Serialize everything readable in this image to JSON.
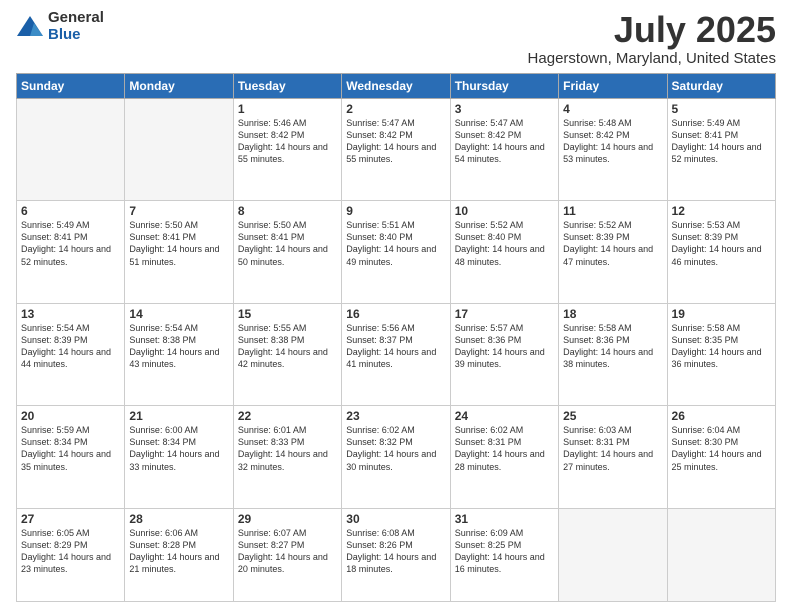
{
  "logo": {
    "general": "General",
    "blue": "Blue"
  },
  "title": "July 2025",
  "location": "Hagerstown, Maryland, United States",
  "days_of_week": [
    "Sunday",
    "Monday",
    "Tuesday",
    "Wednesday",
    "Thursday",
    "Friday",
    "Saturday"
  ],
  "weeks": [
    [
      {
        "day": "",
        "info": ""
      },
      {
        "day": "",
        "info": ""
      },
      {
        "day": "1",
        "info": "Sunrise: 5:46 AM\nSunset: 8:42 PM\nDaylight: 14 hours and 55 minutes."
      },
      {
        "day": "2",
        "info": "Sunrise: 5:47 AM\nSunset: 8:42 PM\nDaylight: 14 hours and 55 minutes."
      },
      {
        "day": "3",
        "info": "Sunrise: 5:47 AM\nSunset: 8:42 PM\nDaylight: 14 hours and 54 minutes."
      },
      {
        "day": "4",
        "info": "Sunrise: 5:48 AM\nSunset: 8:42 PM\nDaylight: 14 hours and 53 minutes."
      },
      {
        "day": "5",
        "info": "Sunrise: 5:49 AM\nSunset: 8:41 PM\nDaylight: 14 hours and 52 minutes."
      }
    ],
    [
      {
        "day": "6",
        "info": "Sunrise: 5:49 AM\nSunset: 8:41 PM\nDaylight: 14 hours and 52 minutes."
      },
      {
        "day": "7",
        "info": "Sunrise: 5:50 AM\nSunset: 8:41 PM\nDaylight: 14 hours and 51 minutes."
      },
      {
        "day": "8",
        "info": "Sunrise: 5:50 AM\nSunset: 8:41 PM\nDaylight: 14 hours and 50 minutes."
      },
      {
        "day": "9",
        "info": "Sunrise: 5:51 AM\nSunset: 8:40 PM\nDaylight: 14 hours and 49 minutes."
      },
      {
        "day": "10",
        "info": "Sunrise: 5:52 AM\nSunset: 8:40 PM\nDaylight: 14 hours and 48 minutes."
      },
      {
        "day": "11",
        "info": "Sunrise: 5:52 AM\nSunset: 8:39 PM\nDaylight: 14 hours and 47 minutes."
      },
      {
        "day": "12",
        "info": "Sunrise: 5:53 AM\nSunset: 8:39 PM\nDaylight: 14 hours and 46 minutes."
      }
    ],
    [
      {
        "day": "13",
        "info": "Sunrise: 5:54 AM\nSunset: 8:39 PM\nDaylight: 14 hours and 44 minutes."
      },
      {
        "day": "14",
        "info": "Sunrise: 5:54 AM\nSunset: 8:38 PM\nDaylight: 14 hours and 43 minutes."
      },
      {
        "day": "15",
        "info": "Sunrise: 5:55 AM\nSunset: 8:38 PM\nDaylight: 14 hours and 42 minutes."
      },
      {
        "day": "16",
        "info": "Sunrise: 5:56 AM\nSunset: 8:37 PM\nDaylight: 14 hours and 41 minutes."
      },
      {
        "day": "17",
        "info": "Sunrise: 5:57 AM\nSunset: 8:36 PM\nDaylight: 14 hours and 39 minutes."
      },
      {
        "day": "18",
        "info": "Sunrise: 5:58 AM\nSunset: 8:36 PM\nDaylight: 14 hours and 38 minutes."
      },
      {
        "day": "19",
        "info": "Sunrise: 5:58 AM\nSunset: 8:35 PM\nDaylight: 14 hours and 36 minutes."
      }
    ],
    [
      {
        "day": "20",
        "info": "Sunrise: 5:59 AM\nSunset: 8:34 PM\nDaylight: 14 hours and 35 minutes."
      },
      {
        "day": "21",
        "info": "Sunrise: 6:00 AM\nSunset: 8:34 PM\nDaylight: 14 hours and 33 minutes."
      },
      {
        "day": "22",
        "info": "Sunrise: 6:01 AM\nSunset: 8:33 PM\nDaylight: 14 hours and 32 minutes."
      },
      {
        "day": "23",
        "info": "Sunrise: 6:02 AM\nSunset: 8:32 PM\nDaylight: 14 hours and 30 minutes."
      },
      {
        "day": "24",
        "info": "Sunrise: 6:02 AM\nSunset: 8:31 PM\nDaylight: 14 hours and 28 minutes."
      },
      {
        "day": "25",
        "info": "Sunrise: 6:03 AM\nSunset: 8:31 PM\nDaylight: 14 hours and 27 minutes."
      },
      {
        "day": "26",
        "info": "Sunrise: 6:04 AM\nSunset: 8:30 PM\nDaylight: 14 hours and 25 minutes."
      }
    ],
    [
      {
        "day": "27",
        "info": "Sunrise: 6:05 AM\nSunset: 8:29 PM\nDaylight: 14 hours and 23 minutes."
      },
      {
        "day": "28",
        "info": "Sunrise: 6:06 AM\nSunset: 8:28 PM\nDaylight: 14 hours and 21 minutes."
      },
      {
        "day": "29",
        "info": "Sunrise: 6:07 AM\nSunset: 8:27 PM\nDaylight: 14 hours and 20 minutes."
      },
      {
        "day": "30",
        "info": "Sunrise: 6:08 AM\nSunset: 8:26 PM\nDaylight: 14 hours and 18 minutes."
      },
      {
        "day": "31",
        "info": "Sunrise: 6:09 AM\nSunset: 8:25 PM\nDaylight: 14 hours and 16 minutes."
      },
      {
        "day": "",
        "info": ""
      },
      {
        "day": "",
        "info": ""
      }
    ]
  ]
}
